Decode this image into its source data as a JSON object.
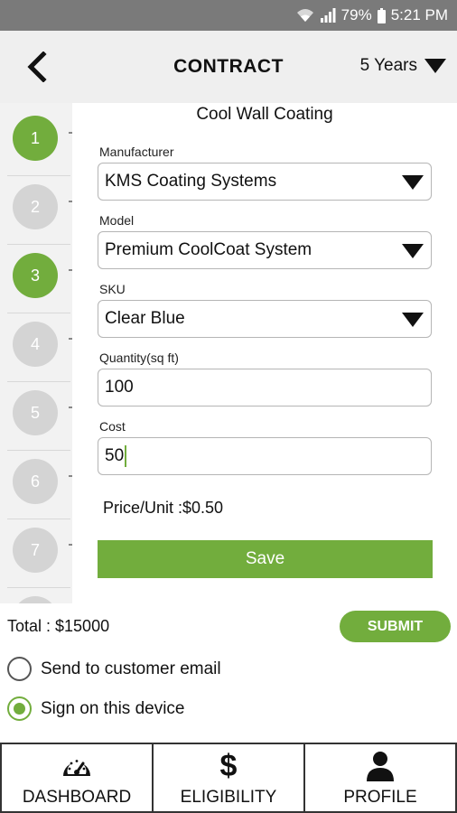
{
  "status_bar": {
    "battery": "79%",
    "time": "5:21 PM"
  },
  "header": {
    "title": "CONTRACT",
    "term": "5 Years"
  },
  "stepper": {
    "steps": [
      {
        "number": "1",
        "state": "complete"
      },
      {
        "number": "2",
        "state": "incomplete"
      },
      {
        "number": "3",
        "state": "complete"
      },
      {
        "number": "4",
        "state": "incomplete"
      },
      {
        "number": "5",
        "state": "incomplete"
      },
      {
        "number": "6",
        "state": "incomplete"
      },
      {
        "number": "7",
        "state": "incomplete"
      }
    ]
  },
  "form": {
    "heading": "Cool Wall Coating",
    "manufacturer": {
      "label": "Manufacturer",
      "value": "KMS Coating Systems"
    },
    "model": {
      "label": "Model",
      "value": "Premium CoolCoat System"
    },
    "sku": {
      "label": "SKU",
      "value": "Clear Blue"
    },
    "quantity": {
      "label": "Quantity(sq ft)",
      "value": "100"
    },
    "cost": {
      "label": "Cost",
      "value": "50"
    },
    "price_unit": "Price/Unit :$0.50",
    "save_label": "Save"
  },
  "summary": {
    "total": "Total : $15000",
    "submit_label": "SUBMIT",
    "options": [
      {
        "label": "Send to customer email",
        "selected": false
      },
      {
        "label": "Sign on this device",
        "selected": true
      }
    ]
  },
  "tabs": [
    {
      "label": "DASHBOARD",
      "icon": "speedometer-icon"
    },
    {
      "label": "ELIGIBILITY",
      "icon": "dollar-icon"
    },
    {
      "label": "PROFILE",
      "icon": "person-icon"
    }
  ],
  "colors": {
    "accent": "#72ad3d",
    "status_bar": "#7a7a7a",
    "header": "#efefef",
    "step_inactive": "#d4d4d4"
  }
}
